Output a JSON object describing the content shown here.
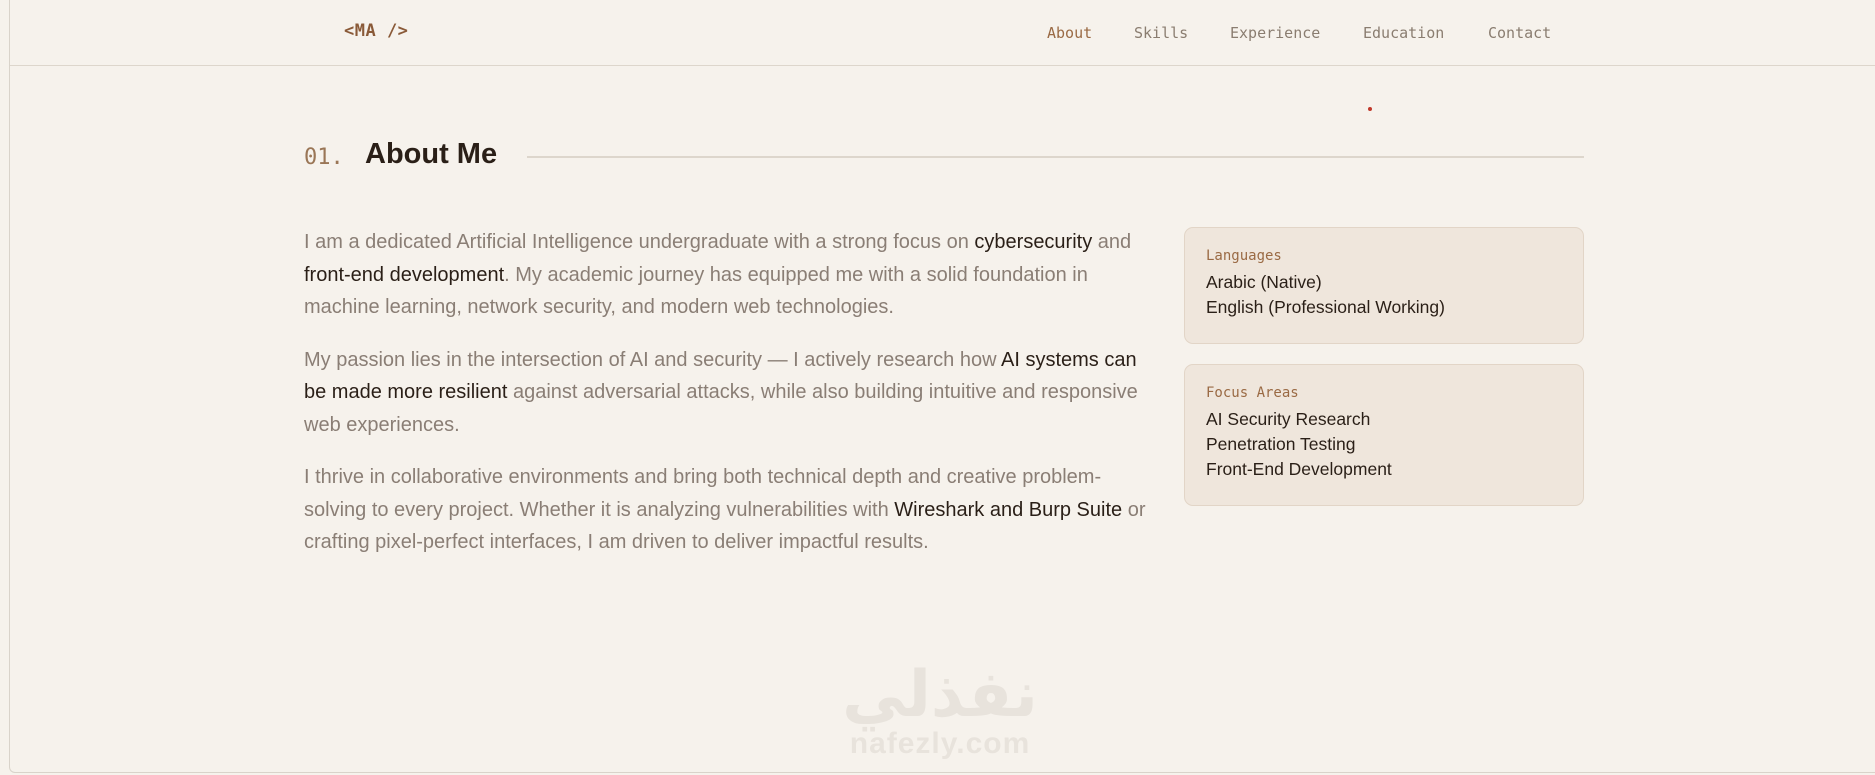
{
  "nav": {
    "logo": "<MA />",
    "links": [
      "About",
      "Skills",
      "Experience",
      "Education",
      "Contact"
    ],
    "active": "About"
  },
  "section": {
    "number": "01.",
    "title": "About Me"
  },
  "about": {
    "p1": {
      "t1": "I am a dedicated Artificial Intelligence undergraduate with a strong focus on ",
      "h1": "cybersecurity",
      "t2": " and ",
      "h2": "front-end development",
      "t3": ". My academic journey has equipped me with a solid foundation in machine learning, network security, and modern web technologies."
    },
    "p2": {
      "t1": "My passion lies in the intersection of AI and security — I actively research how ",
      "h1": "AI systems can be made more resilient",
      "t2": " against adversarial attacks, while also building intuitive and responsive web experiences."
    },
    "p3": {
      "t1": "I thrive in collaborative environments and bring both technical depth and creative problem-solving to every project. Whether it is analyzing vulnerabilities with ",
      "h1": "Wireshark and Burp Suite",
      "t2": " or crafting pixel-perfect interfaces, I am driven to deliver impactful results."
    }
  },
  "cards": {
    "languages": {
      "label": "Languages",
      "items": [
        "Arabic (Native)",
        "English (Professional Working)"
      ]
    },
    "focus": {
      "label": "Focus Areas",
      "items": [
        "AI Security Research",
        "Penetration Testing",
        "Front-End Development"
      ]
    }
  },
  "watermark": {
    "arabic": "نفذلي",
    "latin": "nafezly.com"
  },
  "colors": {
    "background": "#f6f2ec",
    "accent": "#9a6a44",
    "heading": "#2a1f17",
    "body_text": "#8a7e75",
    "card_bg": "#efe6dc"
  }
}
